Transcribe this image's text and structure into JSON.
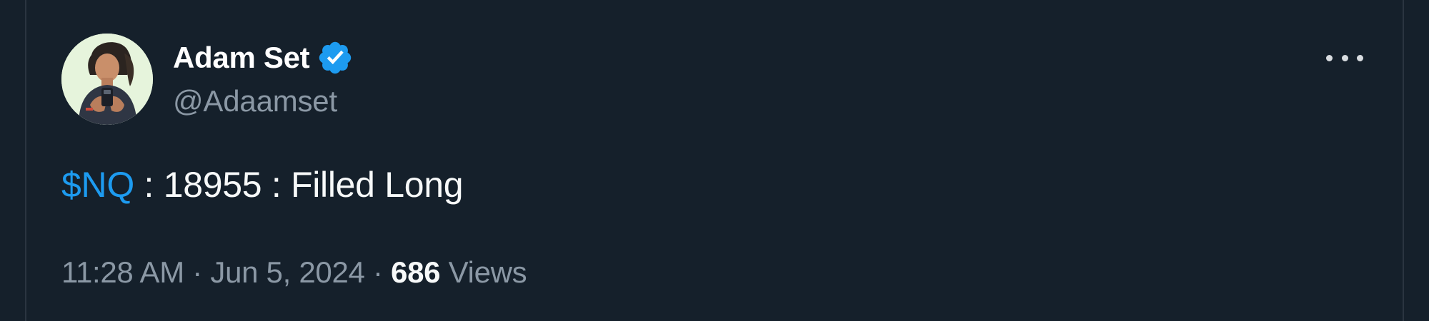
{
  "author": {
    "display_name": "Adam Set",
    "handle": "@Adaamset",
    "verified_icon": "verified-badge-icon",
    "avatar": "profile-photo"
  },
  "tweet": {
    "cashtag": "$NQ",
    "text_rest": " : 18955 : Filled Long"
  },
  "meta": {
    "time": "11:28 AM",
    "separator": " · ",
    "date": "Jun 5, 2024",
    "views_count": "686",
    "views_label": " Views"
  },
  "colors": {
    "background": "#15202b",
    "accent": "#1d9bf0",
    "secondary_text": "#8b98a5",
    "primary_text": "#f7f9f9"
  },
  "icons": {
    "more": "more-horizontal-icon"
  }
}
